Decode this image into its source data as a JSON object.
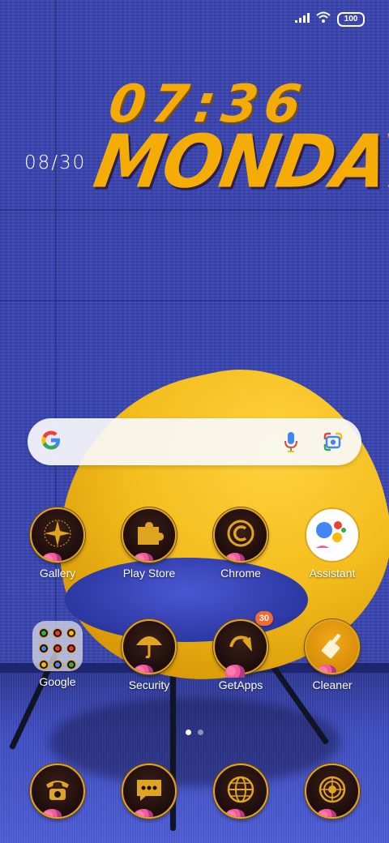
{
  "status_bar": {
    "battery": "100",
    "signal_icon": "signal-bars-icon",
    "wifi_icon": "wifi-icon"
  },
  "clock_widget": {
    "date": "08/30",
    "time": "07:36",
    "day": "MONDAY"
  },
  "search_bar": {
    "logo_icon": "google-g-icon",
    "mic_icon": "microphone-icon",
    "lens_icon": "google-lens-icon"
  },
  "apps_row1": [
    {
      "label": "Gallery",
      "icon": "compass-star-icon"
    },
    {
      "label": "Play Store",
      "icon": "puzzle-icon"
    },
    {
      "label": "Chrome",
      "icon": "copyright-c-icon"
    },
    {
      "label": "Assistant",
      "icon": "google-assistant-icon"
    }
  ],
  "apps_row2": [
    {
      "label": "Google",
      "icon": "google-folder-icon"
    },
    {
      "label": "Security",
      "icon": "umbrella-icon"
    },
    {
      "label": "GetApps",
      "icon": "arrow-curve-icon",
      "badge": "30"
    },
    {
      "label": "Cleaner",
      "icon": "broom-icon"
    }
  ],
  "dock": [
    {
      "icon": "telephone-icon"
    },
    {
      "icon": "chat-bubble-icon"
    },
    {
      "icon": "globe-icon"
    },
    {
      "icon": "camera-aperture-icon"
    }
  ],
  "page_indicator": {
    "pages": 2,
    "active": 1
  },
  "colors": {
    "accent_gold": "#e0a520",
    "wallpaper_blue": "#3b48b4",
    "chair_yellow": "#f3bd1d",
    "badge_orange": "#f26a30"
  }
}
